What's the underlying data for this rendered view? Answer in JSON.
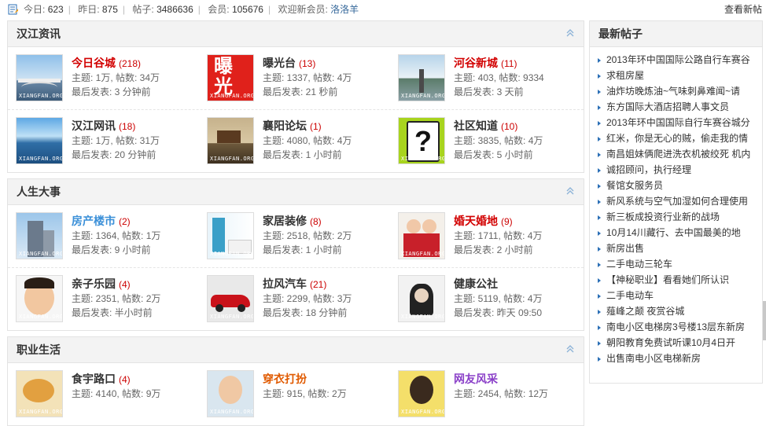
{
  "topbar": {
    "today_label": "今日:",
    "today_value": "623",
    "yesterday_label": "昨日:",
    "yesterday_value": "875",
    "posts_label": "帖子:",
    "posts_value": "3486636",
    "members_label": "会员:",
    "members_value": "105676",
    "welcome_label": "欢迎新会员:",
    "welcome_member": "洛洛羊",
    "view_new": "查看新帖"
  },
  "watermark": "XIANGFAN.ORG",
  "sections": [
    {
      "title": "汉江资讯",
      "rows": [
        [
          {
            "name": "今日谷城",
            "count": "(218)",
            "name_color": "#d20000",
            "topics": "主题: 1万",
            "posts": "帖数: 34万",
            "last": "最后发表: 3 分钟前",
            "thumb": "bridge"
          },
          {
            "name": "曝光台",
            "count": "(13)",
            "name_color": "#333333",
            "topics": "主题: 1337",
            "posts": "帖数: 4万",
            "last": "最后发表: 21 秒前",
            "thumb": "expose"
          },
          {
            "name": "河谷新城",
            "count": "(11)",
            "name_color": "#d20000",
            "topics": "主题: 403",
            "posts": "帖数: 9334",
            "last": "最后发表: 3 天前",
            "thumb": "river"
          }
        ],
        [
          {
            "name": "汉江网讯",
            "count": "(18)",
            "name_color": "#333333",
            "topics": "主题: 1万",
            "posts": "帖数: 31万",
            "last": "最后发表: 20 分钟前",
            "thumb": "sea"
          },
          {
            "name": "襄阳论坛",
            "count": "(1)",
            "name_color": "#333333",
            "topics": "主题: 4080",
            "posts": "帖数: 4万",
            "last": "最后发表: 1 小时前",
            "thumb": "city"
          },
          {
            "name": "社区知道",
            "count": "(10)",
            "name_color": "#333333",
            "topics": "主题: 3835",
            "posts": "帖数: 4万",
            "last": "最后发表: 5 小时前",
            "thumb": "question"
          }
        ]
      ]
    },
    {
      "title": "人生大事",
      "rows": [
        [
          {
            "name": "房产楼市",
            "count": "(2)",
            "name_color": "#3a8fd8",
            "topics": "主题: 1364",
            "posts": "帖数: 1万",
            "last": "最后发表: 9 小时前",
            "thumb": "building"
          },
          {
            "name": "家居装修",
            "count": "(8)",
            "name_color": "#333333",
            "topics": "主题: 2518",
            "posts": "帖数: 2万",
            "last": "最后发表: 1 小时前",
            "thumb": "room"
          },
          {
            "name": "婚天婚地",
            "count": "(9)",
            "name_color": "#d20000",
            "topics": "主题: 1711",
            "posts": "帖数: 4万",
            "last": "最后发表: 2 小时前",
            "thumb": "wedding"
          }
        ],
        [
          {
            "name": "亲子乐园",
            "count": "(4)",
            "name_color": "#333333",
            "topics": "主题: 2351",
            "posts": "帖数: 2万",
            "last": "最后发表: 半小时前",
            "thumb": "kid"
          },
          {
            "name": "拉风汽车",
            "count": "(21)",
            "name_color": "#333333",
            "topics": "主题: 2299",
            "posts": "帖数: 3万",
            "last": "最后发表: 18 分钟前",
            "thumb": "car"
          },
          {
            "name": "健康公社",
            "count": "",
            "name_color": "#333333",
            "topics": "主题: 5119",
            "posts": "帖数: 4万",
            "last": "最后发表: 昨天 09:50",
            "thumb": "health"
          }
        ]
      ]
    },
    {
      "title": "职业生活",
      "rows": [
        [
          {
            "name": "食宇路口",
            "count": "(4)",
            "name_color": "#333333",
            "topics": "主题: 4140",
            "posts": "帖数: 9万",
            "last": "",
            "thumb": "food"
          },
          {
            "name": "穿衣打扮",
            "count": "",
            "name_color": "#e05a00",
            "topics": "主题: 915",
            "posts": "帖数: 2万",
            "last": "",
            "thumb": "fashion"
          },
          {
            "name": "网友风采",
            "count": "",
            "name_color": "#8a3fc8",
            "topics": "主题: 2454",
            "posts": "帖数: 12万",
            "last": "",
            "thumb": "girl"
          }
        ]
      ]
    }
  ],
  "sidebar": {
    "title": "最新帖子",
    "items": [
      "2013年环中国国际公路自行车赛谷",
      "求租房屋",
      "油炸坊晚炼油~气味刺鼻难闻~请",
      "东方国际大酒店招聘人事文员",
      "2013年环中国国际自行车赛谷城分",
      "红米，你是无心的贼，偷走我的情",
      "南昌姐妹俩爬进洗衣机被绞死 机内",
      "诚招顾问，执行经理",
      "餐馆女服务员",
      "新风系统与空气加湿如何合理使用",
      "新三板成投资行业新的战场",
      "10月14川藏行、去中国最美的地",
      "新房出售",
      "二手电动三轮车",
      "【神秘职业】看看她们所认识",
      "二手电动车",
      "薤峰之颠 夜赏谷城",
      "南电小区电梯房3号楼13层东新房",
      "朝阳教育免费试听课10月4日开",
      "出售南电小区电梯新房"
    ]
  }
}
